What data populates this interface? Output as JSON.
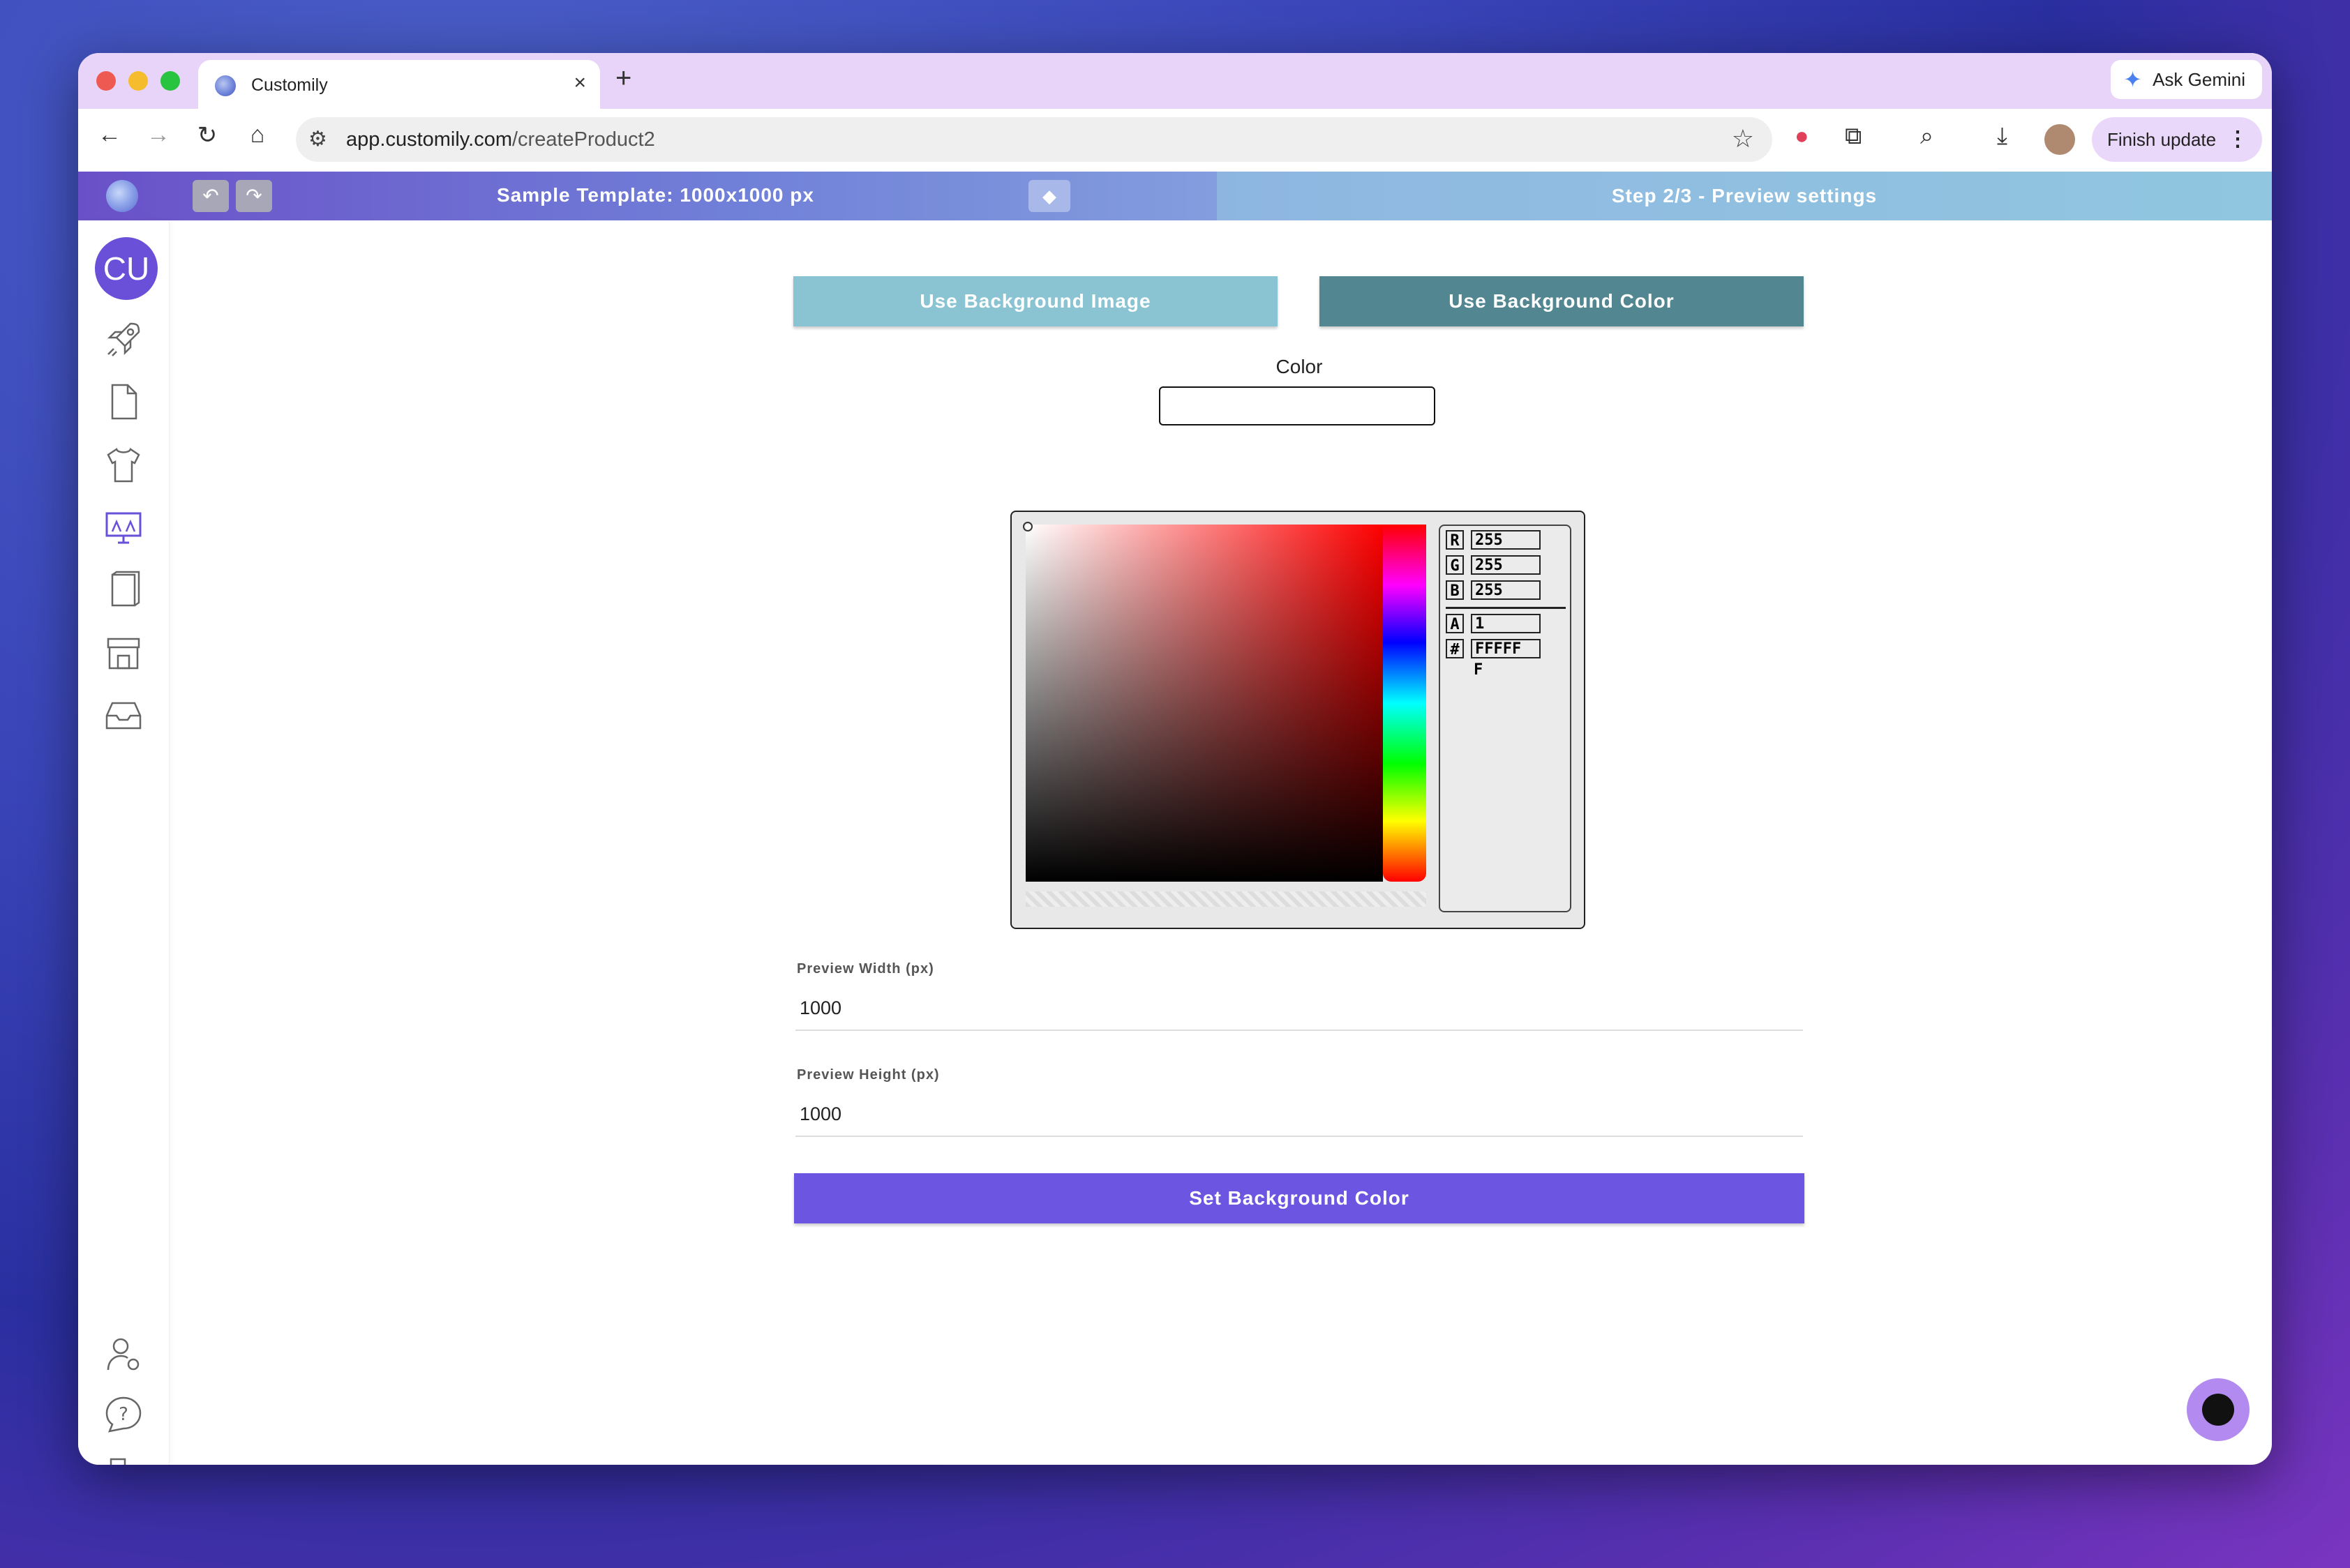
{
  "browser": {
    "tab_title": "Customily",
    "tab_close": "×",
    "new_tab": "+",
    "ask_gemini": "Ask Gemini",
    "url_domain": "app.customily.com",
    "url_path": "/createProduct2",
    "finish_update": "Finish update"
  },
  "header": {
    "template_title": "Sample Template: 1000x1000 px",
    "step": "Step 2/3 - Preview settings"
  },
  "sidebar": {
    "avatar": "CU",
    "icons": [
      "rocket-icon",
      "document-icon",
      "tshirt-icon",
      "monitor-icon",
      "book-icon",
      "store-icon",
      "inbox-icon",
      "user-settings-icon",
      "help-icon",
      "logout-icon"
    ]
  },
  "main": {
    "use_bg_image": "Use Background Image",
    "use_bg_color": "Use Background Color",
    "color_label": "Color",
    "picker": {
      "r": "255",
      "g": "255",
      "b": "255",
      "a": "1",
      "hex": "FFFFF",
      "hex_overflow": "F"
    },
    "preview_width_label": "Preview Width (px)",
    "preview_width_value": "1000",
    "preview_height_label": "Preview Height (px)",
    "preview_height_value": "1000",
    "set_bg_color": "Set Background Color"
  },
  "colors": {
    "accent": "#6c55e0",
    "bg_image_btn": "#8ac4d2",
    "bg_color_btn": "#528690"
  }
}
